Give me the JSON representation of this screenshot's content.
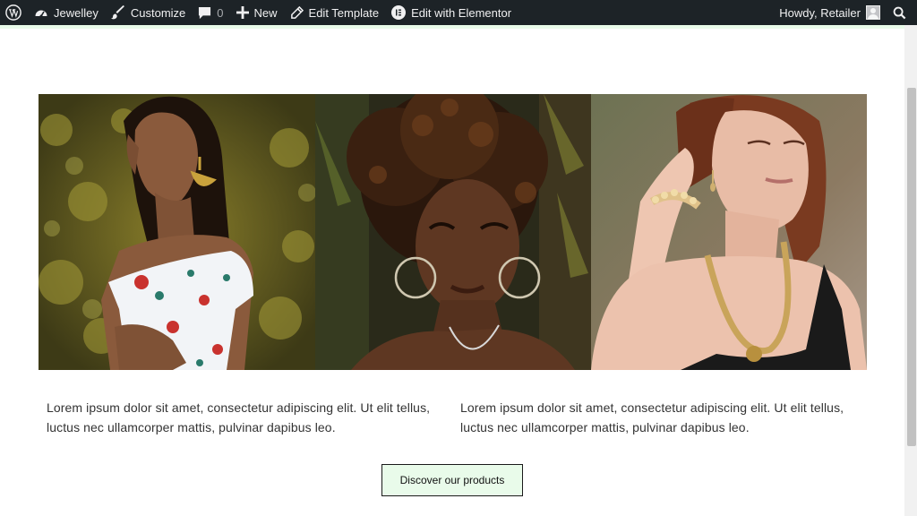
{
  "admin_bar": {
    "site_name": "Jewelley",
    "customize_label": "Customize",
    "comments_count": "0",
    "new_label": "New",
    "edit_template_label": "Edit Template",
    "elementor_label": "Edit with Elementor",
    "greeting": "Howdy, Retailer",
    "icons": [
      "wordpress-icon",
      "dashboard-icon",
      "brush-icon",
      "comment-icon",
      "plus-icon",
      "pencil-icon",
      "elementor-icon",
      "user-avatar",
      "search-icon"
    ]
  },
  "gallery": {
    "images": [
      {
        "subject": "woman in floral off-shoulder top with gold earrings"
      },
      {
        "subject": "woman with curly hair wearing hoop earrings"
      },
      {
        "subject": "woman with red hair wearing pearl bracelet and gold necklace"
      }
    ]
  },
  "content": {
    "left_text": "Lorem ipsum dolor sit amet, consectetur adipiscing elit. Ut elit tellus, luctus nec ullamcorper mattis, pulvinar dapibus leo.",
    "right_text": "Lorem ipsum dolor sit amet, consectetur adipiscing elit. Ut elit tellus, luctus nec ullamcorper mattis, pulvinar dapibus leo."
  },
  "cta": {
    "label": "Discover our products"
  },
  "colors": {
    "admin_bar": "#1d2327",
    "accent_green": "#e9fbea",
    "text": "#333333"
  }
}
